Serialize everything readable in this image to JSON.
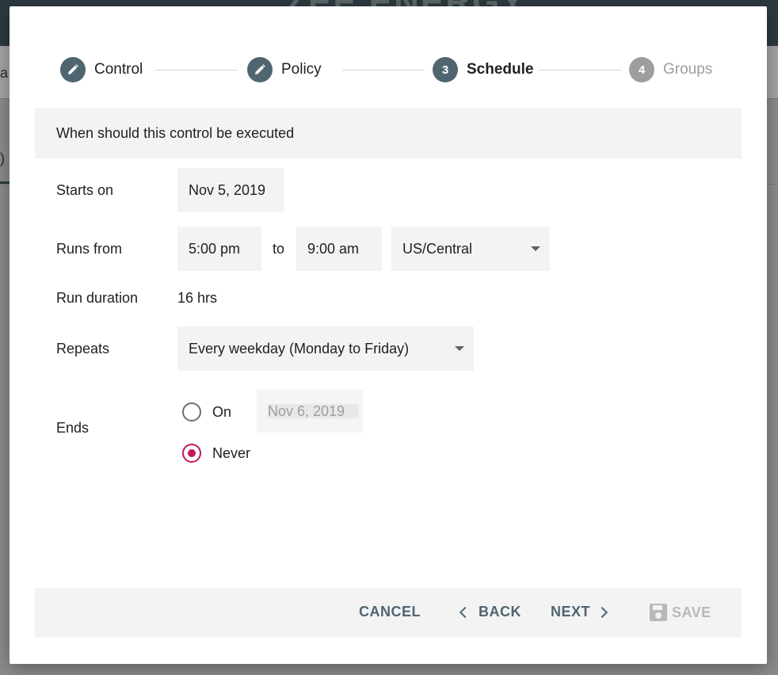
{
  "background": {
    "brand": "ZEE ENERGY",
    "left_text_1": "a",
    "left_text_2": ")"
  },
  "stepper": {
    "steps": [
      {
        "label": "Control",
        "icon": "pencil-icon",
        "state": "done"
      },
      {
        "label": "Policy",
        "icon": "pencil-icon",
        "state": "done"
      },
      {
        "label": "Schedule",
        "number": "3",
        "state": "active"
      },
      {
        "label": "Groups",
        "number": "4",
        "state": "inactive"
      }
    ]
  },
  "section": {
    "title": "When should this control be executed"
  },
  "form": {
    "starts_on": {
      "label": "Starts on",
      "value": "Nov 5, 2019"
    },
    "runs_from": {
      "label": "Runs from",
      "start": "5:00 pm",
      "separator": "to",
      "end": "9:00 am",
      "timezone": "US/Central"
    },
    "run_duration": {
      "label": "Run duration",
      "value": "16 hrs"
    },
    "repeats": {
      "label": "Repeats",
      "value": "Every weekday (Monday to Friday)"
    },
    "ends": {
      "label": "Ends",
      "on_label": "On",
      "on_date": "Nov 6, 2019",
      "never_label": "Never",
      "selected": "never"
    }
  },
  "footer": {
    "cancel": "CANCEL",
    "back": "BACK",
    "next": "NEXT",
    "save": "SAVE"
  },
  "colors": {
    "accent": "#4f6570",
    "radio_selected": "#c2185b",
    "panel": "#f3f3f3"
  }
}
